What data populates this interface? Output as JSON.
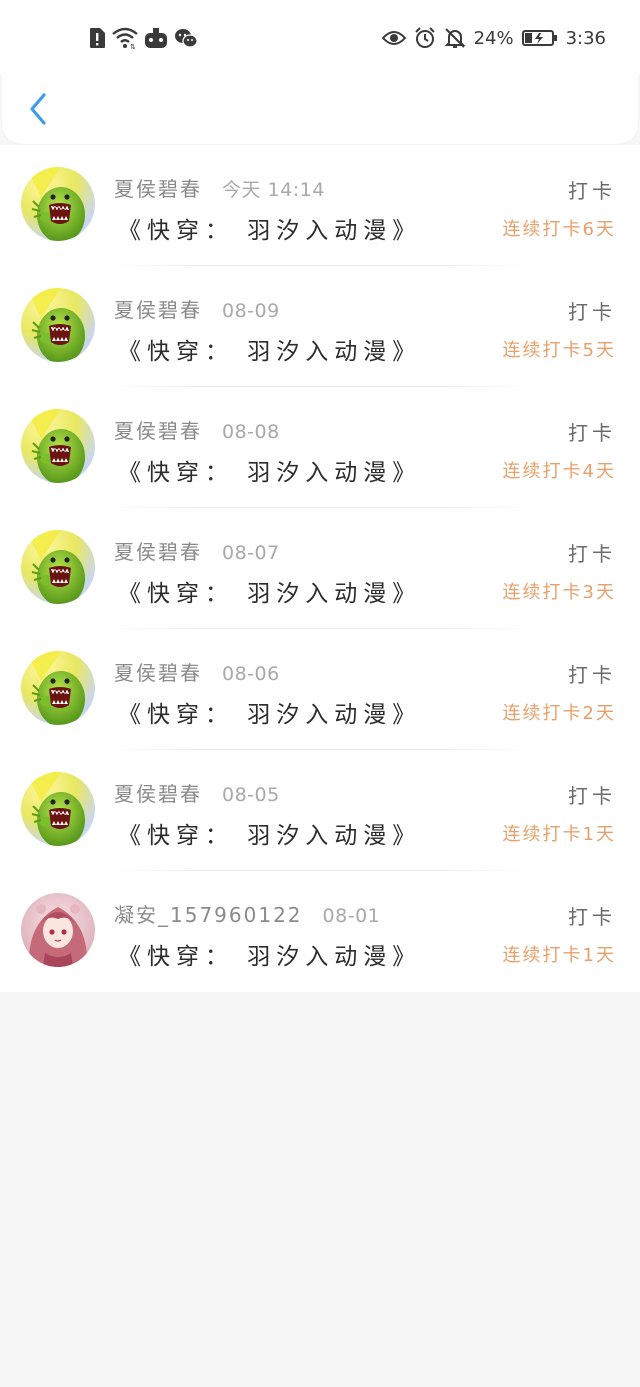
{
  "status_bar": {
    "left_icons": [
      "sim-alert-icon",
      "wifi-icon",
      "game-app-icon",
      "wechat-icon"
    ],
    "right_icons": [
      "eye-icon",
      "alarm-icon",
      "bell-off-icon",
      "battery-icon"
    ],
    "battery_text": "24%",
    "time": "3:36"
  },
  "header": {
    "back_icon": "chevron-left-icon",
    "accent_color": "#3d9be9"
  },
  "checkins": [
    {
      "user": "夏侯碧春",
      "date": "今天 14:14",
      "book": "《快穿： 羽汐入动漫》",
      "action": "打卡",
      "streak": "连续打卡6天",
      "avatar": "green-monster"
    },
    {
      "user": "夏侯碧春",
      "date": "08-09",
      "book": "《快穿： 羽汐入动漫》",
      "action": "打卡",
      "streak": "连续打卡5天",
      "avatar": "green-monster"
    },
    {
      "user": "夏侯碧春",
      "date": "08-08",
      "book": "《快穿： 羽汐入动漫》",
      "action": "打卡",
      "streak": "连续打卡4天",
      "avatar": "green-monster"
    },
    {
      "user": "夏侯碧春",
      "date": "08-07",
      "book": "《快穿： 羽汐入动漫》",
      "action": "打卡",
      "streak": "连续打卡3天",
      "avatar": "green-monster"
    },
    {
      "user": "夏侯碧春",
      "date": "08-06",
      "book": "《快穿： 羽汐入动漫》",
      "action": "打卡",
      "streak": "连续打卡2天",
      "avatar": "green-monster"
    },
    {
      "user": "夏侯碧春",
      "date": "08-05",
      "book": "《快穿： 羽汐入动漫》",
      "action": "打卡",
      "streak": "连续打卡1天",
      "avatar": "green-monster"
    },
    {
      "user": "凝安_157960122",
      "date": "08-01",
      "book": "《快穿： 羽汐入动漫》",
      "action": "打卡",
      "streak": "连续打卡1天",
      "avatar": "anime-girl"
    }
  ],
  "colors": {
    "streak": "#e8a06a",
    "background": "#f8f7f8"
  }
}
